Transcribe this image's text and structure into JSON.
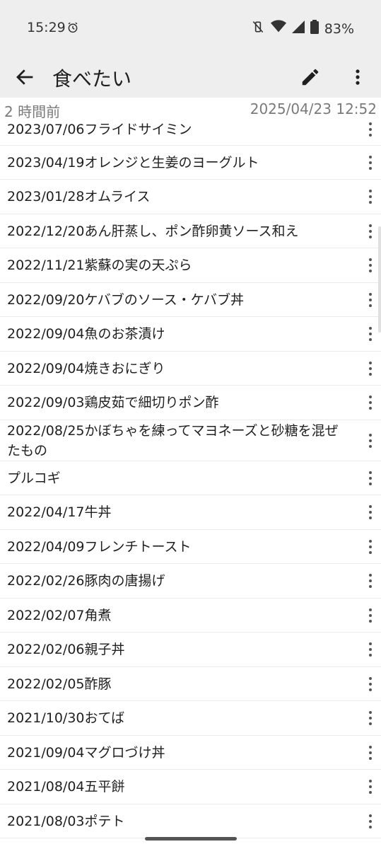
{
  "status_bar": {
    "time": "15:29",
    "battery": "83%"
  },
  "app_bar": {
    "title": "食べたい"
  },
  "meta": {
    "relative_time": "2 時間前",
    "timestamp": "2025/04/23 12:52"
  },
  "items": [
    {
      "text": "2023/07/06フライドサイミン",
      "h": 46
    },
    {
      "text": "2023/04/19オレンジと生姜のヨーグルト",
      "h": 48
    },
    {
      "text": "2023/01/28オムライス",
      "h": 49
    },
    {
      "text": "2022/12/20あん肝蒸し、ポン酢卵黄ソース和え",
      "h": 48
    },
    {
      "text": "2022/11/21紫蘇の実の天ぷら",
      "h": 49
    },
    {
      "text": "2022/09/20ケバブのソース・ケバブ丼",
      "h": 48
    },
    {
      "text": "2022/09/04魚のお茶漬け",
      "h": 49
    },
    {
      "text": "2022/09/04焼きおにぎり",
      "h": 48
    },
    {
      "text": "2022/09/03鶏皮茹で細切りポン酢",
      "h": 49
    },
    {
      "text": "2022/08/25かぼちゃを練ってマヨネーズと砂糖を混ぜたもの",
      "h": 58
    },
    {
      "text": "プルコギ",
      "h": 48
    },
    {
      "text": "2022/04/17牛丼",
      "h": 49
    },
    {
      "text": "2022/04/09フレンチトースト",
      "h": 48
    },
    {
      "text": "2022/02/26豚肉の唐揚げ",
      "h": 49
    },
    {
      "text": "2022/02/07角煮",
      "h": 48
    },
    {
      "text": "2022/02/06親子丼",
      "h": 49
    },
    {
      "text": "2022/02/05酢豚",
      "h": 48
    },
    {
      "text": "2021/10/30おてば",
      "h": 49
    },
    {
      "text": "2021/09/04マグロづけ丼",
      "h": 48
    },
    {
      "text": "2021/08/04五平餅",
      "h": 49
    },
    {
      "text": "2021/08/03ポテト",
      "h": 48
    }
  ]
}
